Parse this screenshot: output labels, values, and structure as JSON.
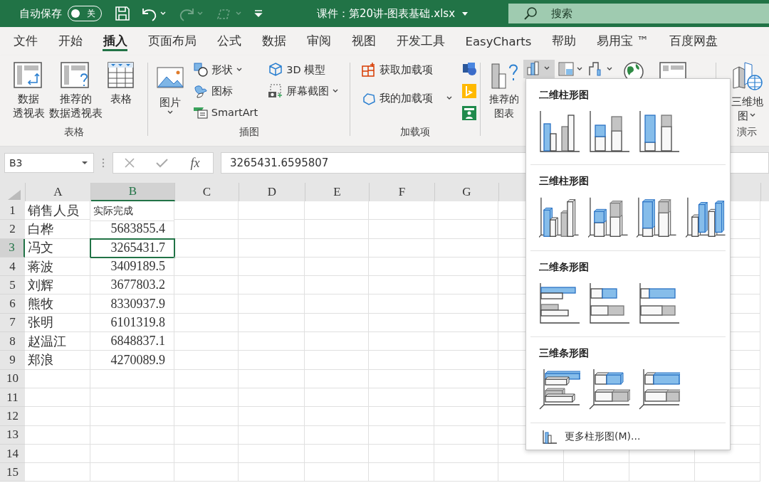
{
  "title_bar": {
    "autosave_label": "自动保存",
    "autosave_toggle": {
      "on": false,
      "label": "关"
    },
    "redo_disabled": true,
    "title": "课件：第20讲-图表基础.xlsx",
    "search": {
      "placeholder": "搜索"
    }
  },
  "tabs": [
    {
      "label": "文件",
      "selected": false
    },
    {
      "label": "开始",
      "selected": false
    },
    {
      "label": "插入",
      "selected": true
    },
    {
      "label": "页面布局",
      "selected": false
    },
    {
      "label": "公式",
      "selected": false
    },
    {
      "label": "数据",
      "selected": false
    },
    {
      "label": "审阅",
      "selected": false
    },
    {
      "label": "视图",
      "selected": false
    },
    {
      "label": "开发工具",
      "selected": false
    },
    {
      "label": "EasyCharts",
      "selected": false
    },
    {
      "label": "帮助",
      "selected": false
    },
    {
      "label": "易用宝 ™",
      "selected": false
    },
    {
      "label": "百度网盘",
      "selected": false
    }
  ],
  "ribbon": {
    "table_group": {
      "label": "表格",
      "buttons": [
        {
          "lines": [
            "数据",
            "透视表"
          ]
        },
        {
          "lines": [
            "推荐的",
            "数据透视表"
          ]
        },
        {
          "lines": [
            "表格"
          ]
        }
      ]
    },
    "illustrations_group": {
      "label": "插图",
      "picture": {
        "lines": [
          "图片"
        ],
        "dropdown": true
      },
      "small_buttons": [
        {
          "label": "形状",
          "dropdown": true
        },
        {
          "label": "图标",
          "dropdown": false
        },
        {
          "label": "SmartArt",
          "dropdown": false
        },
        {
          "label": "3D 模型",
          "dropdown": false
        },
        {
          "label": "屏幕截图",
          "dropdown": true
        }
      ]
    },
    "addins_group": {
      "label": "加载项",
      "buttons": [
        {
          "label": "获取加载项",
          "dropdown": false
        },
        {
          "label": "我的加载项",
          "dropdown": true
        }
      ]
    },
    "charts_group": {
      "recommended": {
        "lines": [
          "推荐的",
          "图表"
        ]
      },
      "column_button": {
        "selected": true
      }
    },
    "tours_group": {
      "label": "演示",
      "map_button": {
        "lines": [
          "三维地",
          "图"
        ],
        "dropdown": true
      }
    }
  },
  "formula_bar": {
    "name_box": "B3",
    "function_label": "fx",
    "formula": "3265431.6595807"
  },
  "sheet": {
    "columns": [
      {
        "label": "A",
        "selected": false
      },
      {
        "label": "B",
        "selected": true
      },
      {
        "label": "C",
        "selected": false
      },
      {
        "label": "D",
        "selected": false
      },
      {
        "label": "E",
        "selected": false
      },
      {
        "label": "F",
        "selected": false
      },
      {
        "label": "G",
        "selected": false
      }
    ],
    "rows": [
      {
        "number": "1",
        "selected": false,
        "cells": [
          {
            "text": "销售人员",
            "active": false
          },
          {
            "text": "实际完成",
            "active": false
          }
        ]
      },
      {
        "number": "2",
        "selected": false,
        "cells": [
          {
            "text": "白桦",
            "active": false
          },
          {
            "text": "5683855.4",
            "active": false
          }
        ]
      },
      {
        "number": "3",
        "selected": true,
        "cells": [
          {
            "text": "冯文",
            "active": false
          },
          {
            "text": "3265431.7",
            "active": true
          }
        ]
      },
      {
        "number": "4",
        "selected": false,
        "cells": [
          {
            "text": "蒋波",
            "active": false
          },
          {
            "text": "3409189.5",
            "active": false
          }
        ]
      },
      {
        "number": "5",
        "selected": false,
        "cells": [
          {
            "text": "刘辉",
            "active": false
          },
          {
            "text": "3677803.2",
            "active": false
          }
        ]
      },
      {
        "number": "6",
        "selected": false,
        "cells": [
          {
            "text": "熊牧",
            "active": false
          },
          {
            "text": "8330937.9",
            "active": false
          }
        ]
      },
      {
        "number": "7",
        "selected": false,
        "cells": [
          {
            "text": "张明",
            "active": false
          },
          {
            "text": "6101319.8",
            "active": false
          }
        ]
      },
      {
        "number": "8",
        "selected": false,
        "cells": [
          {
            "text": "赵温江",
            "active": false
          },
          {
            "text": "6848837.1",
            "active": false
          }
        ]
      },
      {
        "number": "9",
        "selected": false,
        "cells": [
          {
            "text": "郑浪",
            "active": false
          },
          {
            "text": "4270089.9",
            "active": false
          }
        ]
      },
      {
        "number": "10",
        "selected": false,
        "cells": []
      },
      {
        "number": "11",
        "selected": false,
        "cells": []
      },
      {
        "number": "12",
        "selected": false,
        "cells": []
      },
      {
        "number": "13",
        "selected": false,
        "cells": []
      },
      {
        "number": "14",
        "selected": false,
        "cells": []
      },
      {
        "number": "15",
        "selected": false,
        "cells": []
      }
    ]
  },
  "chart_menu": {
    "sections": [
      {
        "title": "二维柱形图",
        "kind": "column",
        "items": [
          {
            "kind": "clustered"
          },
          {
            "kind": "stacked"
          },
          {
            "kind": "percent"
          }
        ]
      },
      {
        "title": "三维柱形图",
        "kind": "column-3d",
        "items": [
          {
            "kind": "clustered"
          },
          {
            "kind": "stacked"
          },
          {
            "kind": "percent"
          },
          {
            "kind": "depth"
          }
        ]
      },
      {
        "title": "二维条形图",
        "kind": "bar",
        "items": [
          {
            "kind": "clustered"
          },
          {
            "kind": "stacked"
          },
          {
            "kind": "percent"
          }
        ]
      },
      {
        "title": "三维条形图",
        "kind": "bar-3d",
        "items": [
          {
            "kind": "clustered"
          },
          {
            "kind": "stacked"
          },
          {
            "kind": "percent"
          }
        ]
      }
    ],
    "more": {
      "label": "更多柱形图(M)..."
    }
  }
}
